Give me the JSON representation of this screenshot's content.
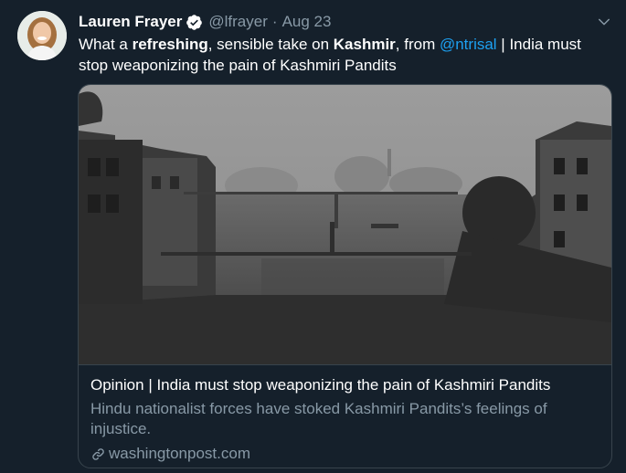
{
  "tweet": {
    "author_name": "Lauren Frayer",
    "handle": "@lfrayer",
    "separator": "·",
    "date": "Aug 23",
    "text": {
      "part1": "What a ",
      "bold1": "refreshing",
      "part2": ", sensible take on ",
      "bold2": "Kashmir",
      "part3": ", from ",
      "mention": "@ntrisal",
      "part4": " | India must stop weaponizing the pain of Kashmiri Pandits"
    }
  },
  "card": {
    "title": "Opinion | India must stop weaponizing the pain of Kashmiri Pandits",
    "description": "Hindu nationalist forces have stoked Kashmiri Pandits’s feelings of injustice.",
    "domain": "washingtonpost.com"
  },
  "icons": {
    "verified": "verified-badge-icon",
    "more": "chevron-down-icon",
    "link": "link-icon"
  },
  "colors": {
    "background": "#15202b",
    "accent": "#1da1f2",
    "secondary_text": "#8899a6",
    "border": "#38444d"
  }
}
